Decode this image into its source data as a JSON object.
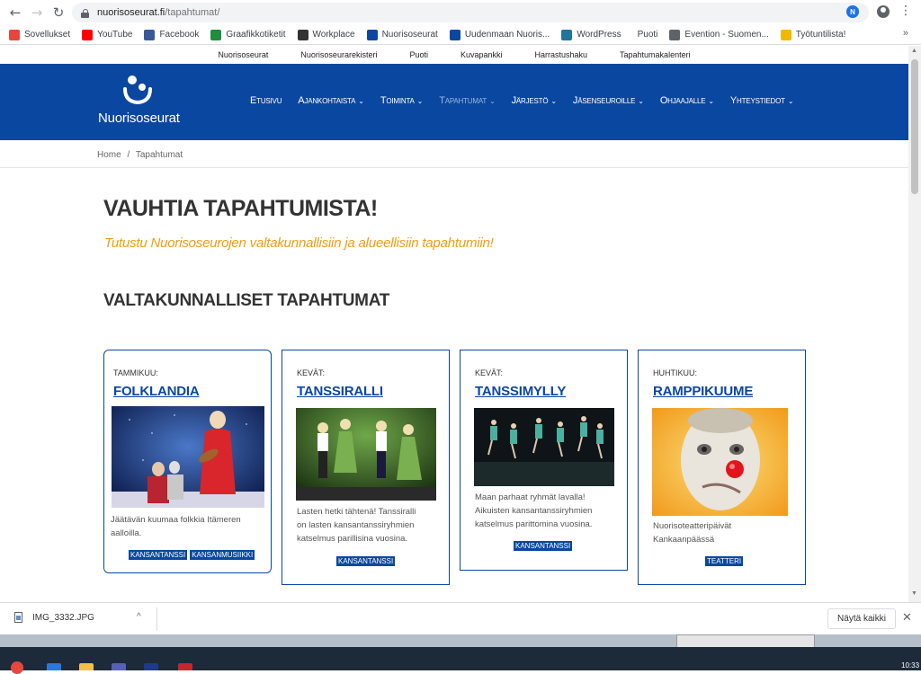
{
  "browser": {
    "url_host": "nuorisoseurat.fi",
    "url_path": "/tapahtumat/",
    "back_icon": "←",
    "forward_icon": "→",
    "reload_icon": "↻",
    "star_icon": "☆",
    "menu_icon": "⋮",
    "ext_label": "N",
    "bookmarks": [
      {
        "label": "Sovellukset",
        "color": "#e8453c"
      },
      {
        "label": "YouTube",
        "color": "#ff0000"
      },
      {
        "label": "Facebook",
        "color": "#3b5998"
      },
      {
        "label": "Graafikkotiketit",
        "color": "#1e8e3e"
      },
      {
        "label": "Workplace",
        "color": "#333333"
      },
      {
        "label": "Nuorisoseurat",
        "color": "#0a47a0"
      },
      {
        "label": "Uudenmaan Nuoris...",
        "color": "#0a47a0"
      },
      {
        "label": "WordPress",
        "color": "#21759b"
      },
      {
        "label": "Puoti",
        "color": "#ffffff"
      },
      {
        "label": "Evention - Suomen...",
        "color": "#5f6368"
      },
      {
        "label": "Työtuntilista!",
        "color": "#f2b705"
      }
    ],
    "more_bookmarks": "»"
  },
  "site": {
    "topbar": [
      "Nuorisoseurat",
      "Nuorisoseurarekisteri",
      "Puoti",
      "Kuvapankki",
      "Harrastushaku",
      "Tapahtumakalenteri"
    ],
    "logo_text": "Nuorisoseurat",
    "nav": [
      {
        "label": "Etusivu",
        "chevron": false,
        "active": false
      },
      {
        "label": "Ajankohtaista",
        "chevron": true,
        "active": false
      },
      {
        "label": "Toiminta",
        "chevron": true,
        "active": false
      },
      {
        "label": "Tapahtumat",
        "chevron": true,
        "active": true
      },
      {
        "label": "Järjestö",
        "chevron": true,
        "active": false
      },
      {
        "label": "Jäsenseuroille",
        "chevron": true,
        "active": false
      },
      {
        "label": "Ohjaajalle",
        "chevron": true,
        "active": false
      },
      {
        "label": "Yhteystiedot",
        "chevron": true,
        "active": false
      }
    ],
    "chevron_glyph": "⌄",
    "breadcrumb": {
      "home": "Home",
      "sep": "/",
      "current": "Tapahtumat"
    }
  },
  "main": {
    "title": "VAUHTIA TAPAHTUMISTA!",
    "subtitle": "Tutustu Nuorisoseurojen valtakunnallisiin ja alueellisiin tapahtumiin!",
    "section_title": "VALTAKUNNALLISET TAPAHTUMAT",
    "cards": [
      {
        "label": "TAMMIKUU:",
        "title": "FOLKLANDIA",
        "desc_lines": [
          "Jäätävän kuumaa folkkia Itämeren",
          "aalloilla."
        ],
        "tags": [
          "KANSANTANSSI",
          "KANSANMUSIIKKI"
        ]
      },
      {
        "label": "KEVÄT:",
        "title": "TANSSIRALLI",
        "desc_lines": [
          "Lasten hetki tähtenä! Tanssiralli",
          "on lasten kansantanssiryhmien",
          "katselmus parillisina vuosina."
        ],
        "tags": [
          "KANSANTANSSI"
        ]
      },
      {
        "label": "KEVÄT:",
        "title": "TANSSIMYLLY",
        "desc_lines": [
          "Maan parhaat ryhmät lavalla!",
          "Aikuisten kansantanssiryhmien",
          "katselmus parittomina vuosina."
        ],
        "tags": [
          "KANSANTANSSI"
        ]
      },
      {
        "label": "HUHTIKUU:",
        "title": "RAMPPIKUUME",
        "desc_lines": [
          "Nuorisoteatteripäivät",
          "Kankaanpäässä"
        ],
        "tags": [
          "TEATTERI"
        ]
      }
    ]
  },
  "downloads": {
    "file_name": "IMG_3332.JPG",
    "chevron": "^",
    "show_all": "Näytä kaikki",
    "close": "✕"
  },
  "taskbar": {
    "clock": "10:33"
  }
}
